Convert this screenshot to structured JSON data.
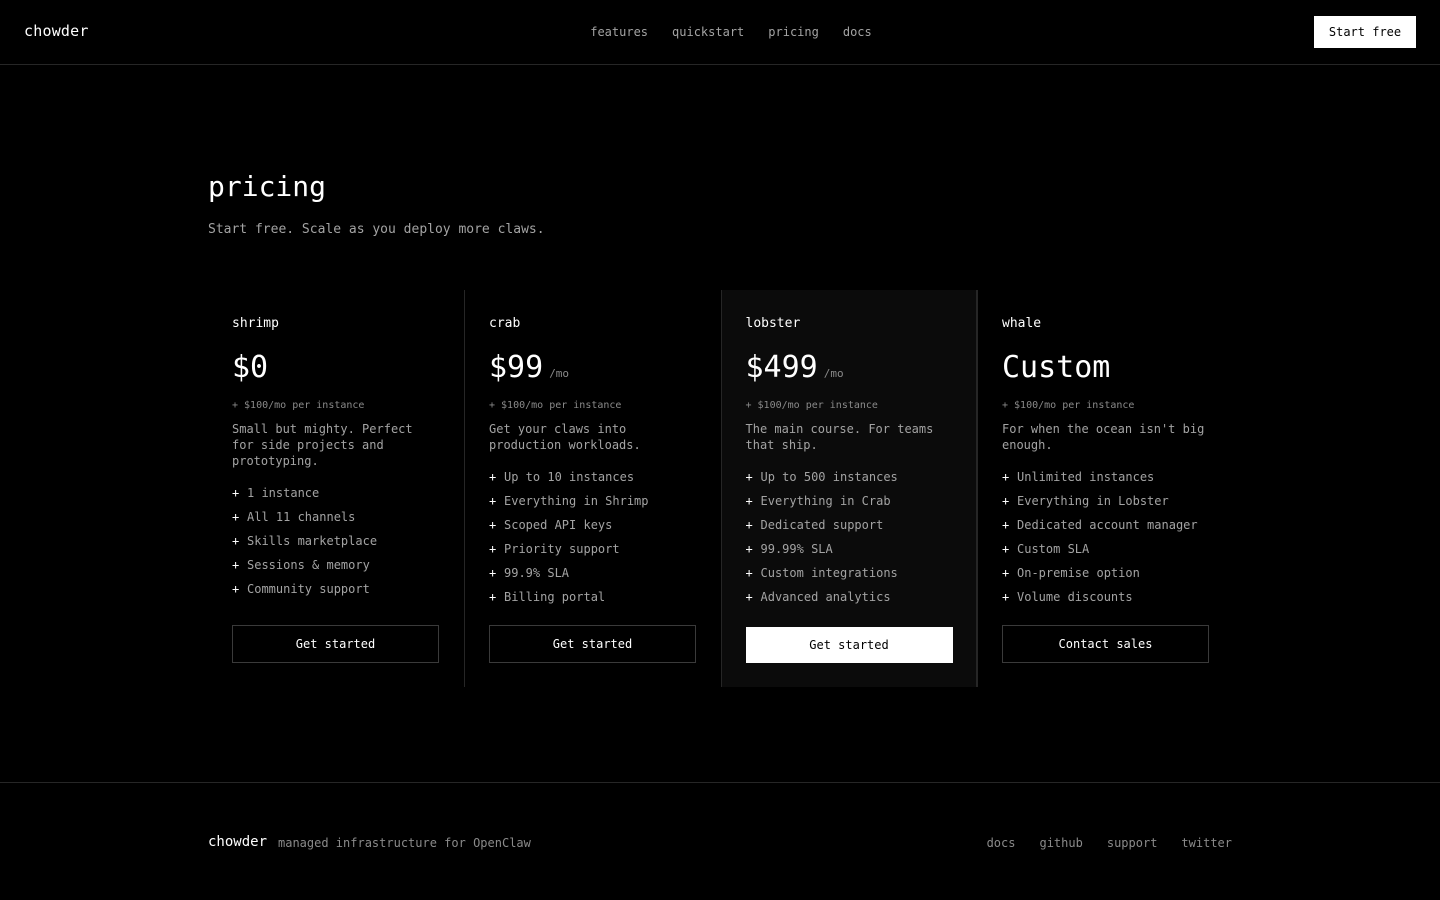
{
  "header": {
    "logo": "chowder",
    "nav": [
      "features",
      "quickstart",
      "pricing",
      "docs"
    ],
    "cta": "Start free"
  },
  "hero": {
    "title": "pricing",
    "subtitle": "Start free. Scale as you deploy more claws."
  },
  "plans": [
    {
      "name": "shrimp",
      "price": "$0",
      "period": "",
      "extra": "+ $100/mo per instance",
      "description": "Small but mighty. Perfect for side projects and prototyping.",
      "features": [
        "1 instance",
        "All 11 channels",
        "Skills marketplace",
        "Sessions & memory",
        "Community support"
      ],
      "cta": "Get started"
    },
    {
      "name": "crab",
      "price": "$99",
      "period": "/mo",
      "extra": "+ $100/mo per instance",
      "description": "Get your claws into production workloads.",
      "features": [
        "Up to 10 instances",
        "Everything in Shrimp",
        "Scoped API keys",
        "Priority support",
        "99.9% SLA",
        "Billing portal"
      ],
      "cta": "Get started"
    },
    {
      "name": "lobster",
      "price": "$499",
      "period": "/mo",
      "extra": "+ $100/mo per instance",
      "description": "The main course. For teams that ship.",
      "features": [
        "Up to 500 instances",
        "Everything in Crab",
        "Dedicated support",
        "99.99% SLA",
        "Custom integrations",
        "Advanced analytics"
      ],
      "cta": "Get started"
    },
    {
      "name": "whale",
      "price": "Custom",
      "period": "",
      "extra": "+ $100/mo per instance",
      "description": "For when the ocean isn't big enough.",
      "features": [
        "Unlimited instances",
        "Everything in Lobster",
        "Dedicated account manager",
        "Custom SLA",
        "On-premise option",
        "Volume discounts"
      ],
      "cta": "Contact sales"
    }
  ],
  "footer": {
    "logo": "chowder",
    "tagline": "managed infrastructure for OpenClaw",
    "links": [
      "docs",
      "github",
      "support",
      "twitter"
    ]
  }
}
